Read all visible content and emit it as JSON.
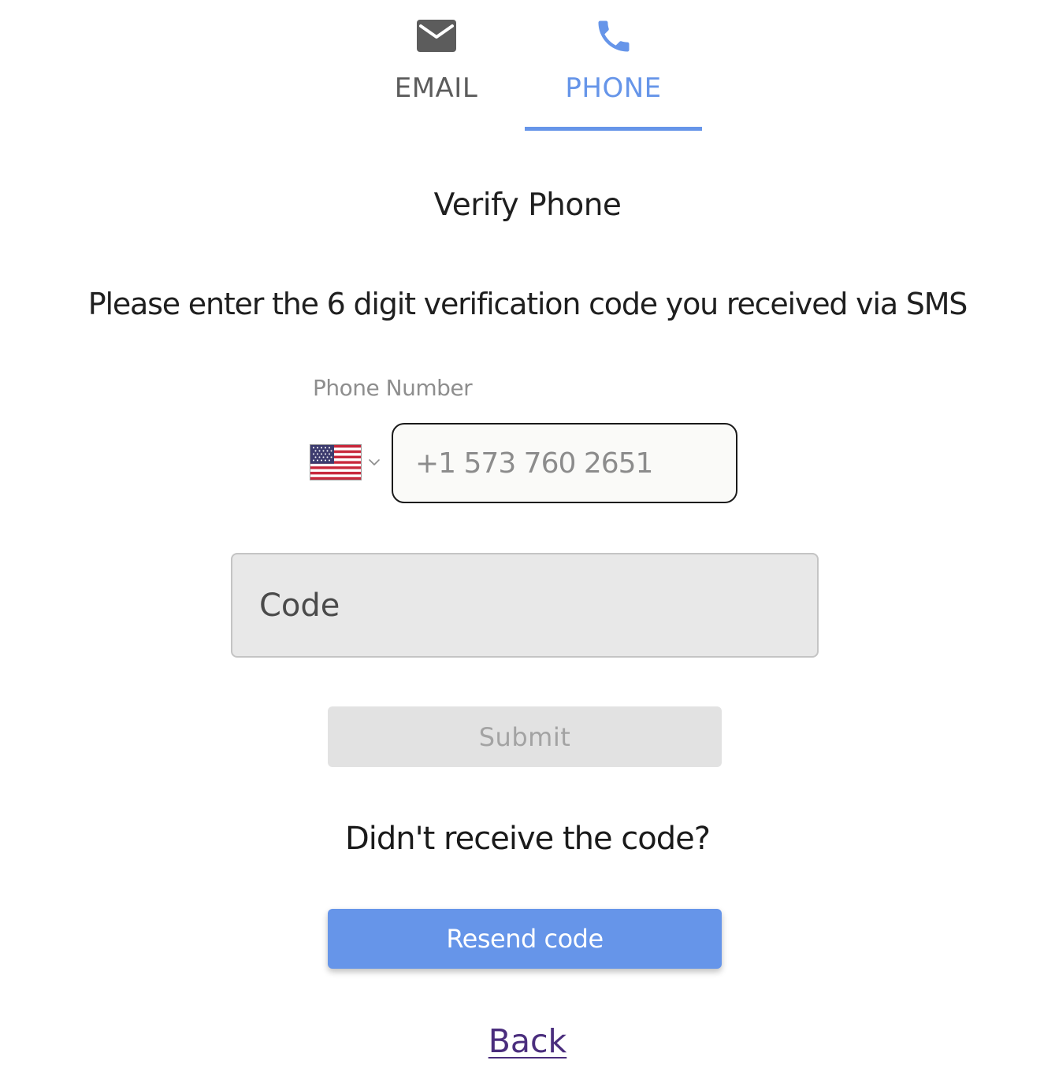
{
  "tabs": {
    "email": {
      "label": "EMAIL",
      "icon": "envelope-icon"
    },
    "phone": {
      "label": "PHONE",
      "icon": "phone-icon",
      "active": true
    }
  },
  "title": "Verify Phone",
  "instructions": "Please enter the 6 digit verification code you received via SMS",
  "phone": {
    "label": "Phone Number",
    "country_flag": "us-flag-icon",
    "value": "+1 573 760 2651"
  },
  "code": {
    "placeholder": "Code",
    "value": ""
  },
  "submit_label": "Submit",
  "resend_question": "Didn't receive the code?",
  "resend_label": "Resend code",
  "back_label": "Back",
  "colors": {
    "accent": "#6695e9",
    "link": "#4a2d7d",
    "disabled_bg": "#e2e2e2",
    "disabled_text": "#a3a3a3"
  }
}
